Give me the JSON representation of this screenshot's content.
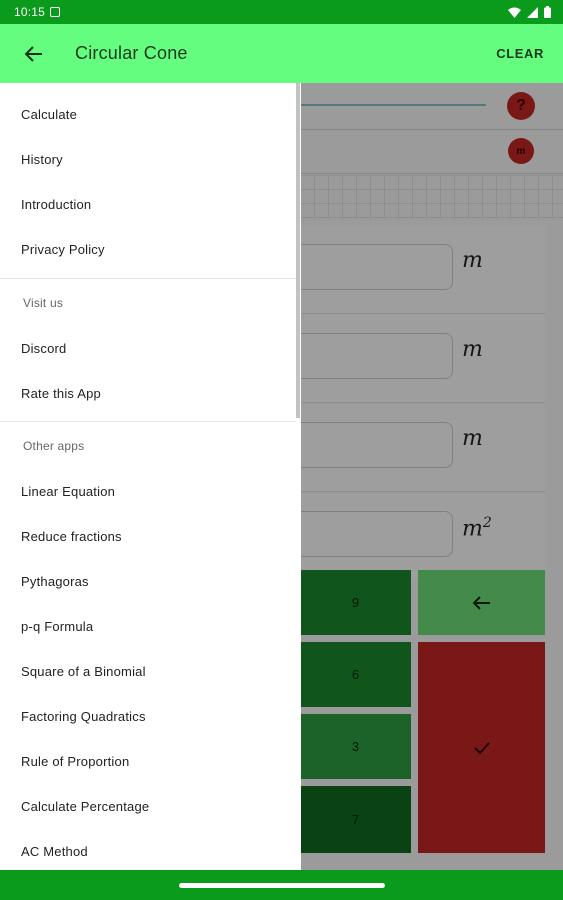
{
  "status_bar": {
    "time": "10:15"
  },
  "app_bar": {
    "title": "Circular Cone",
    "clear_label": "CLEAR"
  },
  "background": {
    "help_label": "?",
    "unit_toggle_label": "m",
    "units": [
      "m",
      "m",
      "m",
      "m"
    ],
    "last_unit_power": "2",
    "keypad": {
      "k9": "9",
      "k6": "6",
      "k3": "3",
      "k7": "7"
    }
  },
  "drawer": {
    "main_items": [
      "Calculate",
      "History",
      "Introduction",
      "Privacy Policy"
    ],
    "visit_label": "Visit us",
    "visit_items": [
      "Discord",
      "Rate this App"
    ],
    "other_label": "Other apps",
    "other_items": [
      "Linear Equation",
      "Reduce fractions",
      "Pythagoras",
      "p-q Formula",
      "Square of a Binomial",
      "Factoring Quadratics",
      "Rule of Proportion",
      "Calculate Percentage",
      "AC Method"
    ]
  },
  "colors": {
    "app_bar": "#64fd7f",
    "status_bar": "#0a9a1c",
    "confirm_key": "#c62828",
    "digit_key": "#1b8c2e"
  }
}
